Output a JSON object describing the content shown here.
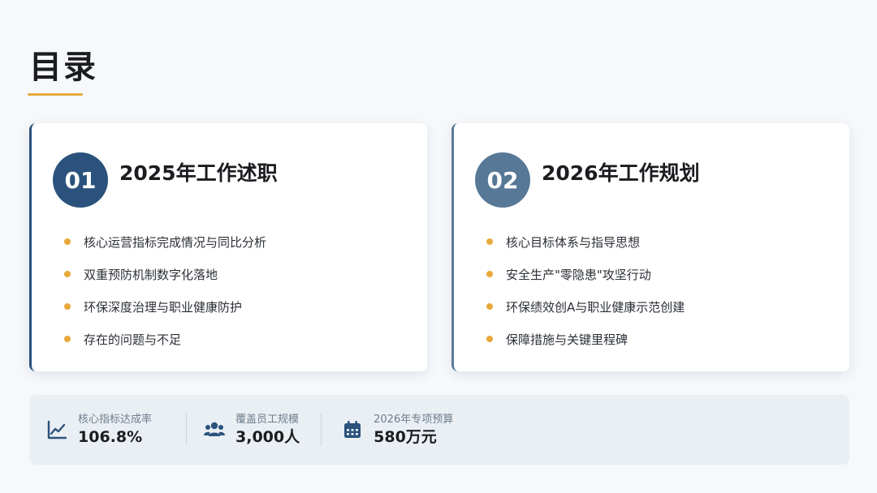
{
  "header": {
    "title": "目录"
  },
  "sections": [
    {
      "number": "01",
      "title": "2025年工作述职",
      "items": [
        "核心运营指标完成情况与同比分析",
        "双重预防机制数字化落地",
        "环保深度治理与职业健康防护",
        "存在的问题与不足"
      ]
    },
    {
      "number": "02",
      "title": "2026年工作规划",
      "items": [
        "核心目标体系与指导思想",
        "安全生产\"零隐患\"攻坚行动",
        "环保绩效创A与职业健康示范创建",
        "保障措施与关键里程碑"
      ]
    }
  ],
  "stats": [
    {
      "icon": "line-chart-icon",
      "label": "核心指标达成率",
      "value": "106.8%"
    },
    {
      "icon": "users-icon",
      "label": "覆盖员工规模",
      "value": "3,000人"
    },
    {
      "icon": "calendar-icon",
      "label": "2026年专项预算",
      "value": "580万元"
    }
  ],
  "colors": {
    "accent": "#e8a93b",
    "primary": "#2a527d",
    "secondary": "#577896"
  }
}
